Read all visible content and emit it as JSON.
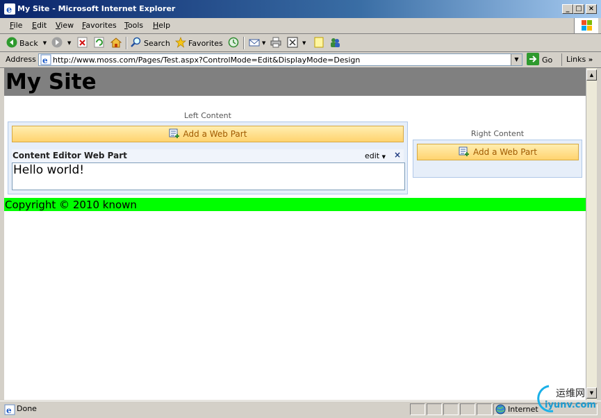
{
  "window": {
    "title": "My Site - Microsoft Internet Explorer"
  },
  "menu": [
    {
      "label": "File",
      "key": "F",
      "rest": "ile"
    },
    {
      "label": "Edit",
      "key": "E",
      "rest": "dit"
    },
    {
      "label": "View",
      "key": "V",
      "rest": "iew"
    },
    {
      "label": "Favorites",
      "key": "F",
      "rest": "avorites"
    },
    {
      "label": "Tools",
      "key": "T",
      "rest": "ools"
    },
    {
      "label": "Help",
      "key": "H",
      "rest": "elp"
    }
  ],
  "toolbar": {
    "back": "Back",
    "search": "Search",
    "favorites": "Favorites"
  },
  "address": {
    "label": "Address",
    "url": "http://www.moss.com/Pages/Test.aspx?ControlMode=Edit&DisplayMode=Design",
    "go": "Go",
    "links": "Links"
  },
  "page": {
    "site_title": "My Site",
    "left_zone_label": "Left Content",
    "right_zone_label": "Right Content",
    "add_web_part": "Add a Web Part",
    "webpart_title": "Content Editor Web Part",
    "webpart_edit": "edit",
    "webpart_close": "×",
    "webpart_body": "Hello world!",
    "footer": "Copyright © 2010 known"
  },
  "status": {
    "text": "Done",
    "zone": "Internet"
  },
  "watermark": {
    "cn": "运维网",
    "domain": "iyunv.com"
  },
  "icons": {
    "back": "back-arrow-icon",
    "forward": "forward-arrow-icon",
    "stop": "stop-icon",
    "refresh": "refresh-icon",
    "home": "home-icon",
    "search": "search-icon",
    "favorites": "favorites-star-icon",
    "history": "history-icon",
    "mail": "mail-icon",
    "print": "print-icon",
    "edit": "edit-page-icon",
    "discuss": "discuss-icon",
    "messenger": "messenger-icon"
  },
  "colors": {
    "header_bg": "#808080",
    "footer_bg": "#00ff00",
    "add_part_text": "#a05a00",
    "titlebar": "#0a246a"
  }
}
